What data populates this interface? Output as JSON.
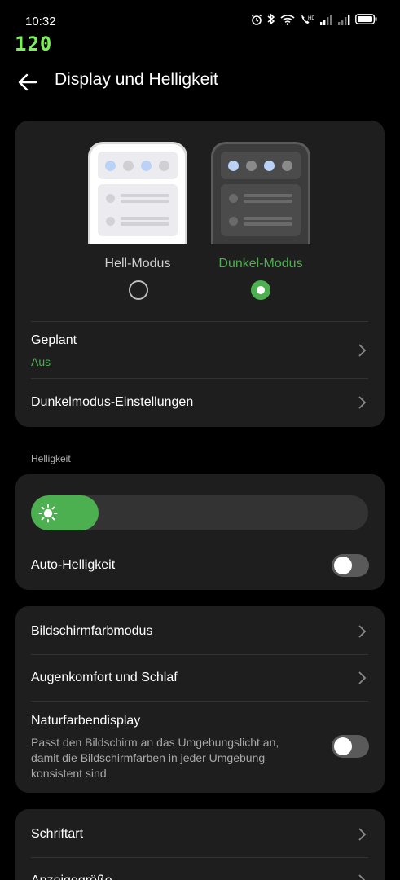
{
  "status_bar": {
    "time": "10:32",
    "fps_indicator": "120",
    "icons": [
      "alarm-icon",
      "bluetooth-icon",
      "wifi-icon",
      "volte-icon",
      "signal-icon",
      "signal-icon",
      "battery-icon"
    ]
  },
  "header": {
    "title": "Display und Helligkeit",
    "back_icon": "arrow-left-icon"
  },
  "theme": {
    "light_label": "Hell-Modus",
    "dark_label": "Dunkel-Modus",
    "selected": "dark",
    "scheduled_label": "Geplant",
    "scheduled_value": "Aus",
    "dark_settings_label": "Dunkelmodus-Einstellungen"
  },
  "brightness": {
    "section_label": "Helligkeit",
    "level": 0.2,
    "auto_label": "Auto-Helligkeit",
    "auto_enabled": false
  },
  "color": {
    "screen_color_mode": "Bildschirmfarbmodus",
    "eye_comfort": "Augenkomfort und Schlaf",
    "natural_color_label": "Naturfarbendisplay",
    "natural_color_desc": "Passt den Bildschirm an das Umgebungslicht an, damit die Bildschirmfarben in jeder Umgebung konsistent sind.",
    "natural_color_enabled": false
  },
  "font": {
    "font_label": "Schriftart",
    "display_size_label": "Anzeigegröße"
  },
  "colors": {
    "accent": "#4caf50",
    "card": "#1e1e1e",
    "background": "#000000"
  }
}
